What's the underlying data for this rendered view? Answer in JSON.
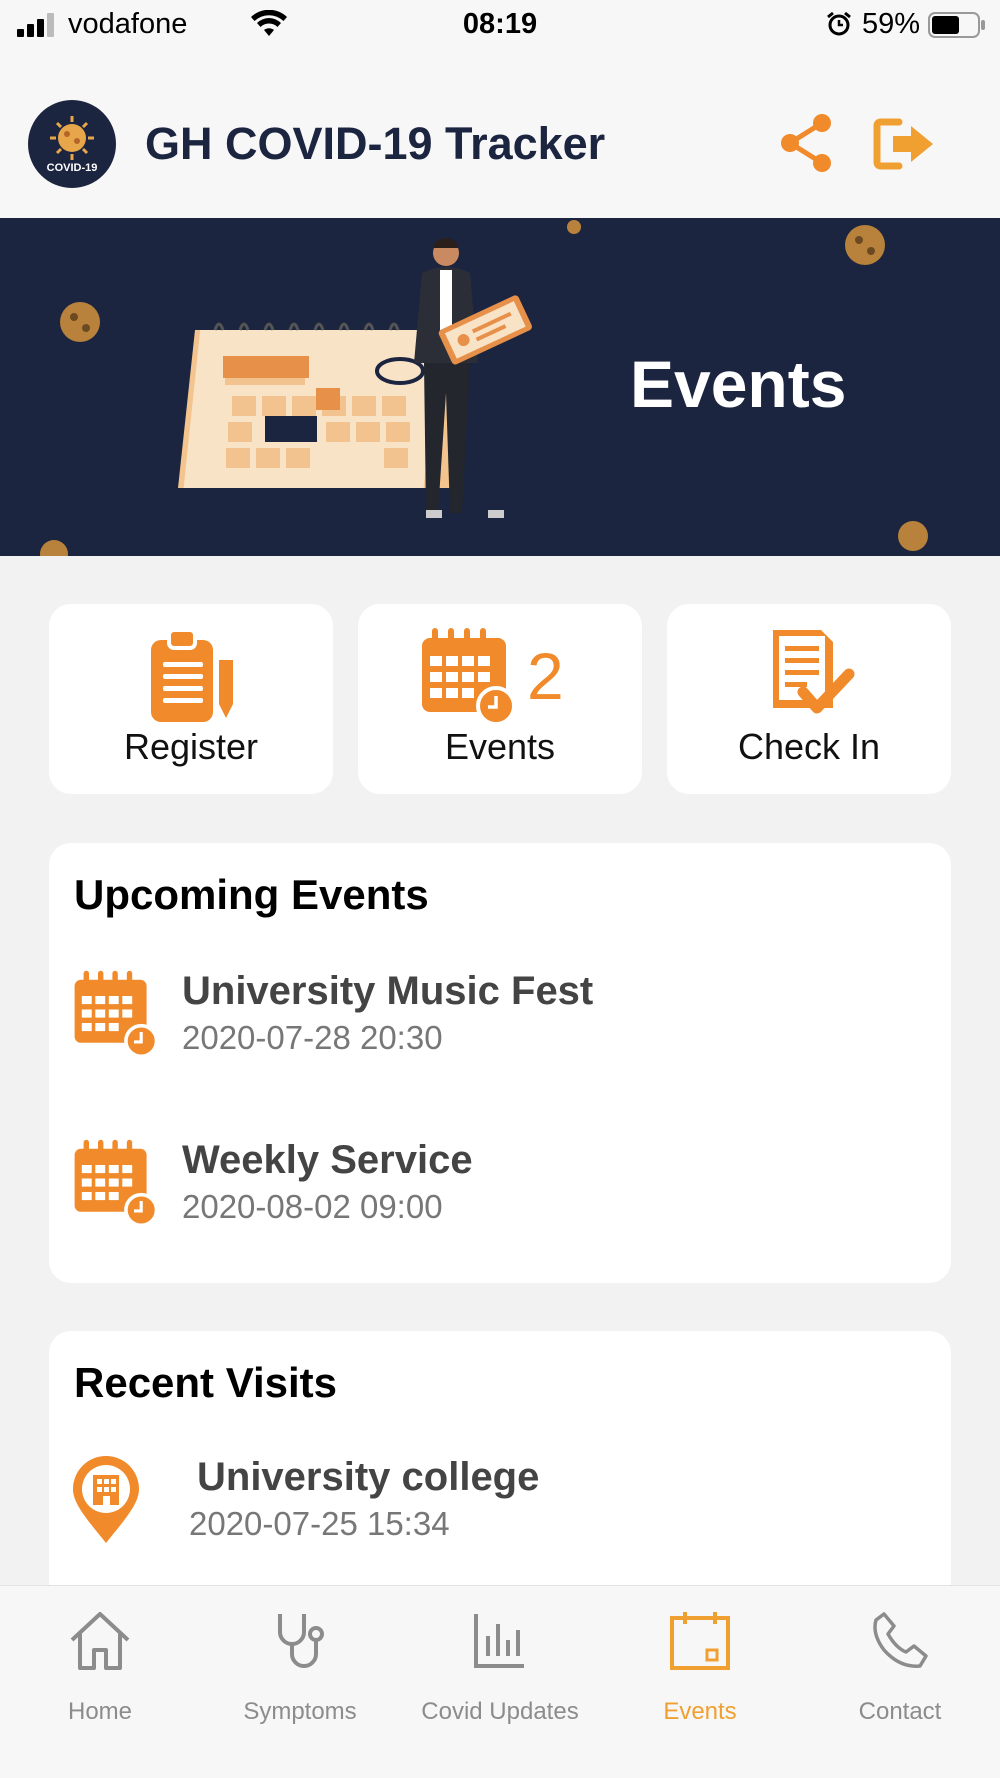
{
  "status_bar": {
    "carrier": "vodafone",
    "time": "08:19",
    "battery": "59%"
  },
  "header": {
    "logo_text": "COVID-19",
    "title": "GH COVID-19 Tracker",
    "share_icon": "share-icon",
    "logout_icon": "logout-icon"
  },
  "banner": {
    "title": "Events"
  },
  "actions": [
    {
      "label": "Register",
      "icon": "clipboard-pen-icon"
    },
    {
      "label": "Events",
      "icon": "calendar-clock-icon",
      "count": "2"
    },
    {
      "label": "Check In",
      "icon": "document-check-icon"
    }
  ],
  "upcoming": {
    "title": "Upcoming Events",
    "items": [
      {
        "name": "University Music Fest",
        "time": "2020-07-28 20:30"
      },
      {
        "name": "Weekly Service",
        "time": "2020-08-02 09:00"
      }
    ]
  },
  "recent": {
    "title": "Recent Visits",
    "items": [
      {
        "name": "University college",
        "time": "2020-07-25 15:34"
      }
    ]
  },
  "nav": {
    "items": [
      {
        "label": "Home",
        "icon": "home-icon"
      },
      {
        "label": "Symptoms",
        "icon": "stethoscope-icon"
      },
      {
        "label": "Covid Updates",
        "icon": "bar-chart-icon"
      },
      {
        "label": "Events",
        "icon": "calendar-icon",
        "active": true
      },
      {
        "label": "Contact",
        "icon": "phone-icon"
      }
    ]
  },
  "colors": {
    "accent": "#f08a2a",
    "navy": "#1c2540",
    "nav_active": "#f0a030"
  }
}
